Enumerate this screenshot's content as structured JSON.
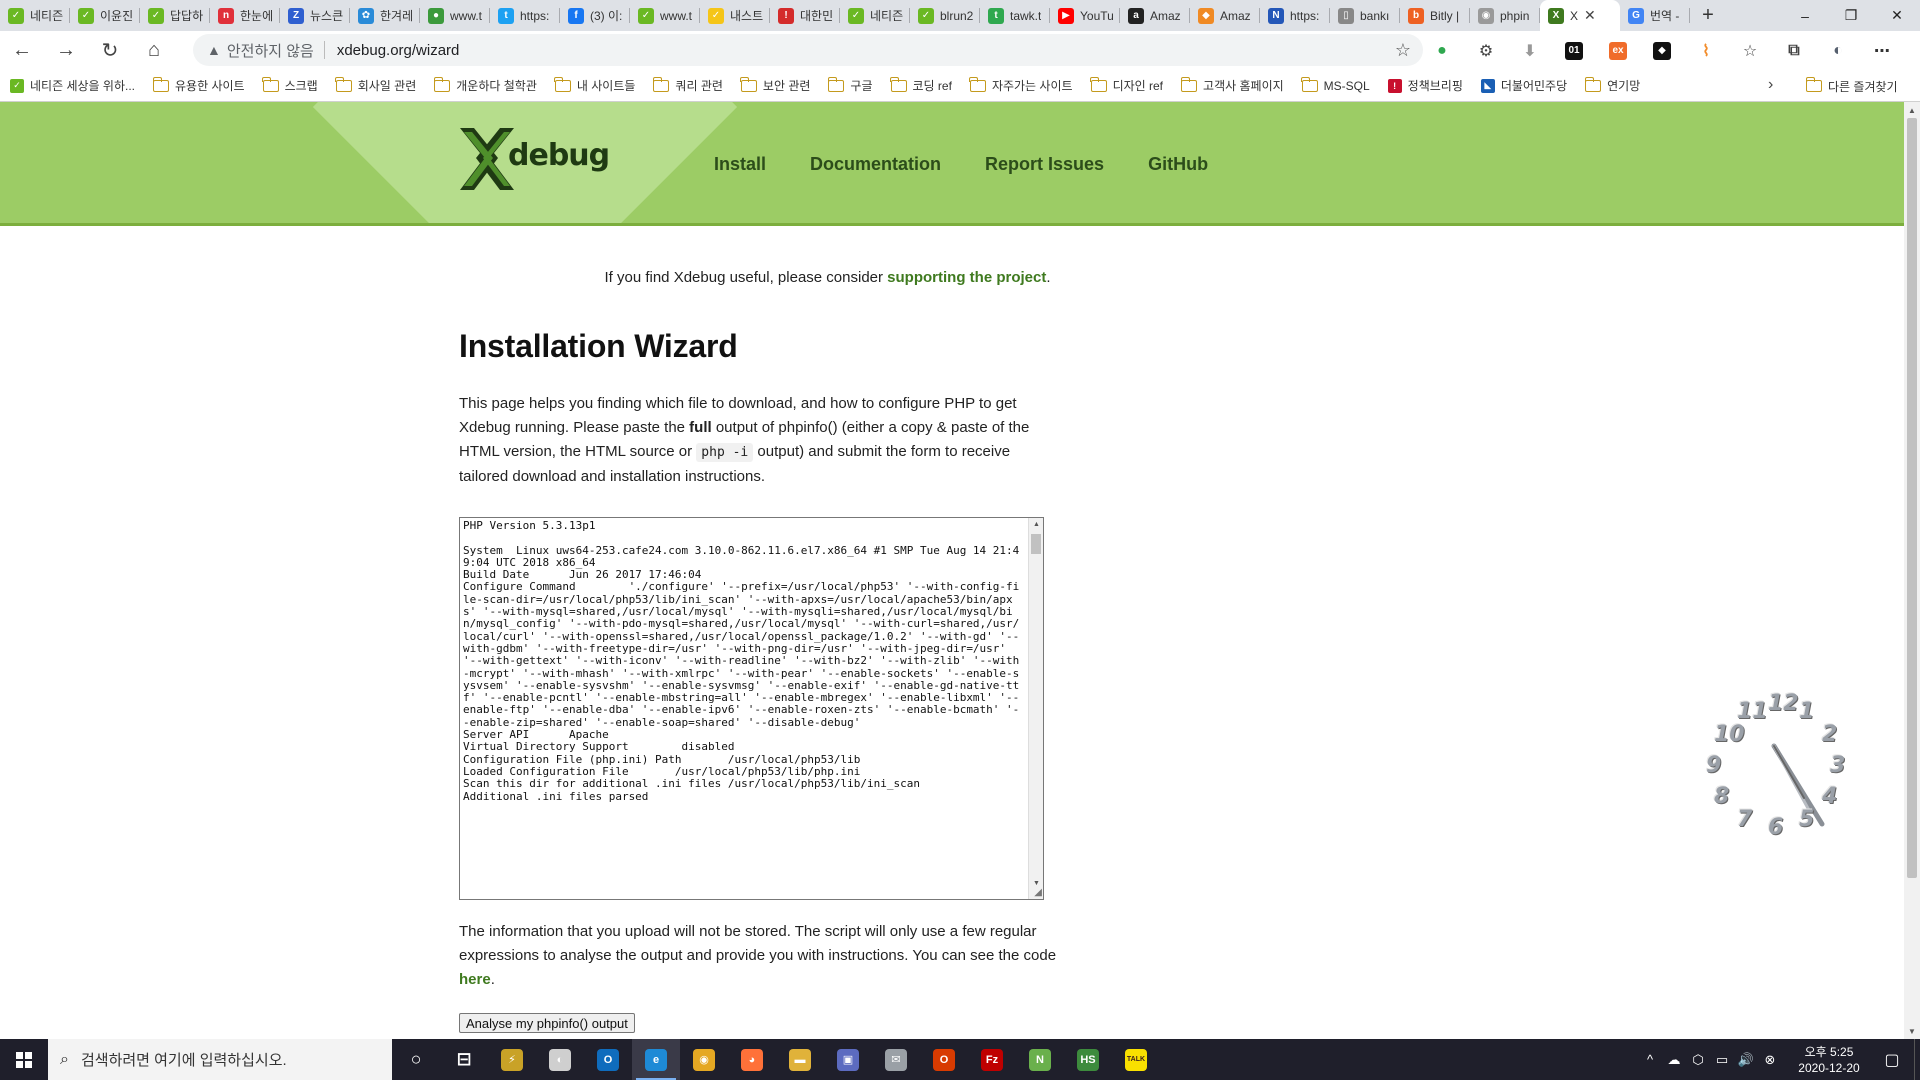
{
  "browser": {
    "tabs": [
      {
        "label": "네티즌",
        "color": "#6ab823",
        "glyph": "✓"
      },
      {
        "label": "이윤진",
        "color": "#6ab823",
        "glyph": "✓"
      },
      {
        "label": "답답하",
        "color": "#6ab823",
        "glyph": "✓"
      },
      {
        "label": "한눈에",
        "color": "#e0303a",
        "glyph": "n"
      },
      {
        "label": "뉴스큰",
        "color": "#2f5fd0",
        "glyph": "Z"
      },
      {
        "label": "한겨레",
        "color": "#2a8bd8",
        "glyph": "✿"
      },
      {
        "label": "www.t",
        "color": "#3c9a3c",
        "glyph": "●"
      },
      {
        "label": "https:",
        "color": "#1da1f2",
        "glyph": "t"
      },
      {
        "label": "(3) 이:",
        "color": "#1877f2",
        "glyph": "f"
      },
      {
        "label": "www.t",
        "color": "#6ab823",
        "glyph": "✓"
      },
      {
        "label": "내스트",
        "color": "#f5c518",
        "glyph": "✓"
      },
      {
        "label": "대한민",
        "color": "#d42b2b",
        "glyph": "!"
      },
      {
        "label": "네티즌",
        "color": "#6ab823",
        "glyph": "✓"
      },
      {
        "label": "blrun2",
        "color": "#6ab823",
        "glyph": "✓"
      },
      {
        "label": "tawk.t",
        "color": "#2fa84f",
        "glyph": "t"
      },
      {
        "label": "YouTu",
        "color": "#ff0000",
        "glyph": "▶"
      },
      {
        "label": "Amaz",
        "color": "#222222",
        "glyph": "a"
      },
      {
        "label": "Amaz",
        "color": "#f08a24",
        "glyph": "◆"
      },
      {
        "label": "https:",
        "color": "#2457b8",
        "glyph": "N"
      },
      {
        "label": "bankı",
        "color": "#888888",
        "glyph": "▯"
      },
      {
        "label": "Bitly |",
        "color": "#ee6123",
        "glyph": "b"
      },
      {
        "label": "phpin",
        "color": "#9a9a9a",
        "glyph": "◉"
      }
    ],
    "active_tab": {
      "label": "X",
      "color": "#3f7a1f",
      "glyph": "X"
    },
    "after_tab": {
      "label": "번역 -",
      "color": "#4285f4",
      "glyph": "G"
    },
    "new_tab": "+",
    "window": {
      "minimize": "–",
      "maximize": "❐",
      "close": "✕"
    },
    "nav": {
      "back": "←",
      "forward": "→",
      "reload": "↻",
      "home": "⌂"
    },
    "security_label": "안전하지 않음",
    "url": "xdebug.org/wizard",
    "star": "☆",
    "extensions": [
      {
        "glyph": "●",
        "color": "#2fa84f"
      },
      {
        "glyph": "⚙",
        "color": "#444444"
      },
      {
        "glyph": "⬇",
        "color": "#999999"
      },
      {
        "glyph": "01",
        "color": "#111111"
      },
      {
        "glyph": "ex",
        "color": "#f06c2a"
      },
      {
        "glyph": "◆",
        "color": "#111111"
      },
      {
        "glyph": "⌇",
        "color": "#f28c2a"
      },
      {
        "glyph": "☆",
        "color": "#444444"
      },
      {
        "glyph": "⧉",
        "color": "#444444"
      },
      {
        "glyph": "◐",
        "color": "#555f6e"
      },
      {
        "glyph": "⋯",
        "color": "#333333"
      }
    ],
    "bookmarks": [
      {
        "label": "네티즌 세상을 위하...",
        "kind": "fav",
        "color": "#6ab823",
        "glyph": "✓"
      },
      {
        "label": "유용한 사이트",
        "kind": "folder"
      },
      {
        "label": "스크랩",
        "kind": "folder"
      },
      {
        "label": "회사일 관련",
        "kind": "folder"
      },
      {
        "label": "개운하다 철학관",
        "kind": "folder"
      },
      {
        "label": "내 사이트들",
        "kind": "folder"
      },
      {
        "label": "쿼리 관련",
        "kind": "folder"
      },
      {
        "label": "보안 관련",
        "kind": "folder"
      },
      {
        "label": "구글",
        "kind": "folder"
      },
      {
        "label": "코딩 ref",
        "kind": "folder"
      },
      {
        "label": "자주가는 사이트",
        "kind": "folder"
      },
      {
        "label": "디자인 ref",
        "kind": "folder"
      },
      {
        "label": "고객사 홈페이지",
        "kind": "folder"
      },
      {
        "label": "MS-SQL",
        "kind": "folder"
      },
      {
        "label": "정책브리핑",
        "kind": "fav",
        "color": "#c8102e",
        "glyph": "!"
      },
      {
        "label": "더불어민주당",
        "kind": "fav",
        "color": "#1a5fb4",
        "glyph": "◣"
      },
      {
        "label": "연기망",
        "kind": "folder"
      }
    ],
    "bookmarks_more": "›",
    "other_bookmarks": "다른 즐겨찾기"
  },
  "site": {
    "logo_text": "debug",
    "nav": [
      "Install",
      "Documentation",
      "Report Issues",
      "GitHub"
    ],
    "support_prefix": "If you find Xdebug useful, please consider ",
    "support_link": "supporting the project",
    "support_suffix": ".",
    "title": "Installation Wizard",
    "intro_1": "This page helps you finding which file to download, and how to configure PHP to get Xdebug running. Please paste the ",
    "intro_bold": "full",
    "intro_2": " output of phpinfo() (either a copy & paste of the HTML version, the HTML source or ",
    "intro_code": "php -i",
    "intro_3": " output) and submit the form to receive tailored download and installation instructions.",
    "phpinfo_text": "PHP Version 5.3.13p1\n\nSystem  Linux uws64-253.cafe24.com 3.10.0-862.11.6.el7.x86_64 #1 SMP Tue Aug 14 21:49:04 UTC 2018 x86_64\nBuild Date      Jun 26 2017 17:46:04\nConfigure Command        './configure' '--prefix=/usr/local/php53' '--with-config-file-scan-dir=/usr/local/php53/lib/ini_scan' '--with-apxs=/usr/local/apache53/bin/apxs' '--with-mysql=shared,/usr/local/mysql' '--with-mysqli=shared,/usr/local/mysql/bin/mysql_config' '--with-pdo-mysql=shared,/usr/local/mysql' '--with-curl=shared,/usr/local/curl' '--with-openssl=shared,/usr/local/openssl_package/1.0.2' '--with-gd' '--with-gdbm' '--with-freetype-dir=/usr' '--with-png-dir=/usr' '--with-jpeg-dir=/usr' '--with-gettext' '--with-iconv' '--with-readline' '--with-bz2' '--with-zlib' '--with-mcrypt' '--with-mhash' '--with-xmlrpc' '--with-pear' '--enable-sockets' '--enable-sysvsem' '--enable-sysvshm' '--enable-sysvmsg' '--enable-exif' '--enable-gd-native-ttf' '--enable-pcntl' '--enable-mbstring=all' '--enable-mbregex' '--enable-libxml' '--enable-ftp' '--enable-dba' '--enable-ipv6' '--enable-roxen-zts' '--enable-bcmath' '--enable-zip=shared' '--enable-soap=shared' '--disable-debug'\nServer API      Apache\nVirtual Directory Support        disabled\nConfiguration File (php.ini) Path       /usr/local/php53/lib\nLoaded Configuration File       /usr/local/php53/lib/php.ini\nScan this dir for additional .ini files /usr/local/php53/lib/ini_scan\nAdditional .ini files parsed",
    "notice_1": "The information that you upload will not be stored. The script will only use a few regular expressions to analyse the output and provide you with instructions. You can see the code ",
    "notice_link": "here",
    "notice_2": ".",
    "analyse_button": "Analyse my phpinfo() output",
    "colors": {
      "header": "#9ccc65",
      "link": "#3f7a1f",
      "nav": "#2c4d1a"
    }
  },
  "clock_numbers": [
    "12",
    "1",
    "2",
    "3",
    "4",
    "5",
    "6",
    "7",
    "8",
    "9",
    "10",
    "11"
  ],
  "taskbar": {
    "search_placeholder": "검색하려면 여기에 입력하십시오.",
    "apps": [
      {
        "glyph": "○",
        "color": "transparent",
        "name": "cortana-icon"
      },
      {
        "glyph": "⊟",
        "color": "transparent",
        "name": "task-view-icon"
      },
      {
        "glyph": "⚡",
        "color": "#c9a227",
        "name": "app-icon"
      },
      {
        "glyph": "◐",
        "color": "#cfcfcf",
        "name": "app-icon"
      },
      {
        "glyph": "O",
        "color": "#0f6cbd",
        "name": "outlook-icon"
      },
      {
        "glyph": "e",
        "color": "#1e8ad6",
        "name": "edge-icon",
        "active": true
      },
      {
        "glyph": "◉",
        "color": "#e5a823",
        "name": "chrome-icon"
      },
      {
        "glyph": "◕",
        "color": "#ff7139",
        "name": "firefox-icon"
      },
      {
        "glyph": "▬",
        "color": "#e0b23a",
        "name": "file-explorer-icon"
      },
      {
        "glyph": "▣",
        "color": "#5c6bc0",
        "name": "store-icon"
      },
      {
        "glyph": "✉",
        "color": "#9aa0a6",
        "name": "mail-icon"
      },
      {
        "glyph": "O",
        "color": "#d83b01",
        "name": "office-icon"
      },
      {
        "glyph": "Fz",
        "color": "#bf0000",
        "name": "filezilla-icon"
      },
      {
        "glyph": "N",
        "color": "#6ab04c",
        "name": "notepad-icon"
      },
      {
        "glyph": "HS",
        "color": "#3d8b3d",
        "name": "app-icon"
      },
      {
        "glyph": "TALK",
        "color": "#f9e000",
        "name": "kakaotalk-icon"
      }
    ],
    "tray": [
      "^",
      "☁",
      "⬡",
      "▭",
      "🔊",
      "⊗"
    ],
    "time": "오후 5:25",
    "date": "2020-12-20",
    "notifications": "▢"
  }
}
